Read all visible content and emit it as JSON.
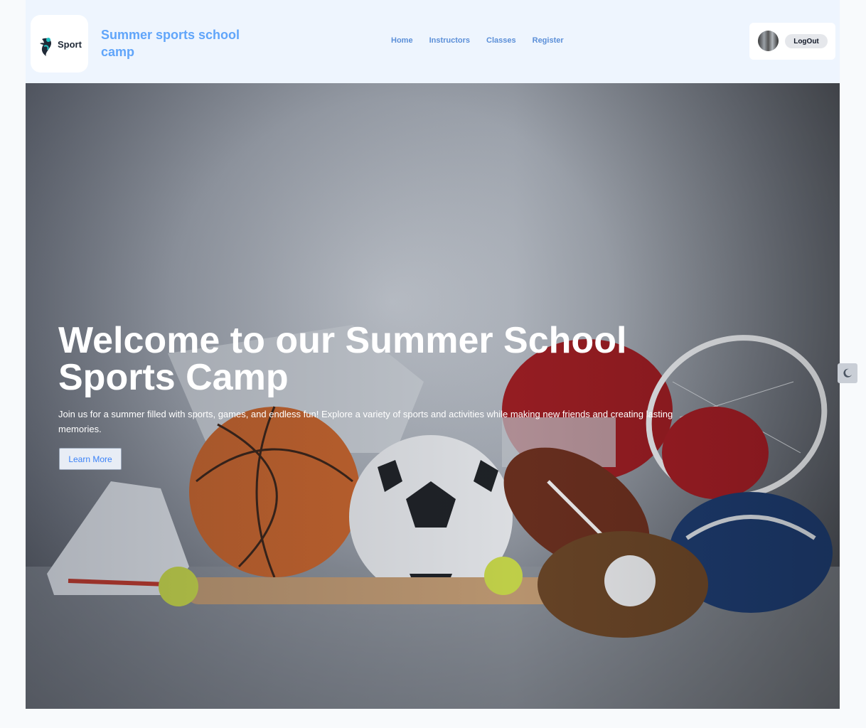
{
  "header": {
    "logo_text": "Sport",
    "brand_title": "Summer sports school camp",
    "nav": [
      {
        "label": "Home"
      },
      {
        "label": "Instructors"
      },
      {
        "label": "Classes"
      },
      {
        "label": "Register"
      }
    ],
    "logout_label": "LogOut"
  },
  "hero": {
    "title": "Welcome to our Summer School Sports Camp",
    "description": "Join us for a summer filled with sports, games, and endless fun! Explore a variety of sports and activities while making new friends and creating lasting memories.",
    "cta_label": "Learn More"
  },
  "icons": {
    "theme_toggle": "moon-icon",
    "logo": "sport-logo-icon"
  },
  "colors": {
    "brand": "#60a5fa",
    "nav_link": "#5b8fd8",
    "navbar_bg": "#eef5fe"
  }
}
